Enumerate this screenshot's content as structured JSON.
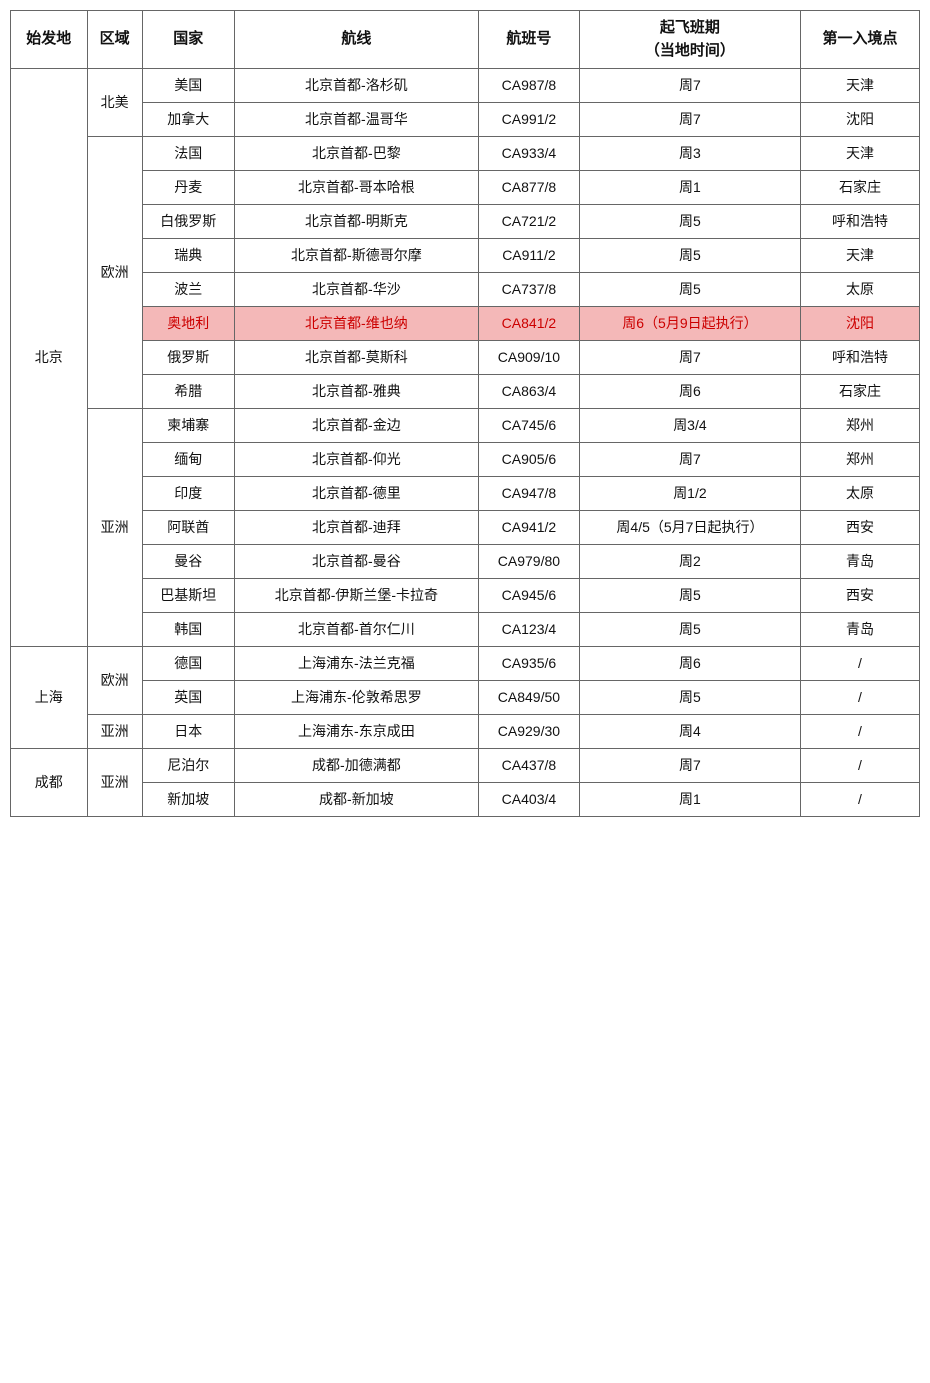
{
  "table": {
    "headers": [
      "始发地",
      "区域",
      "国家",
      "航线",
      "航班号",
      "起飞班期（当地时间）",
      "第一入境点"
    ],
    "rows": [
      {
        "origin": "北京",
        "region": "北美",
        "country": "美国",
        "route": "北京首都-洛杉矶",
        "flight": "CA987/8",
        "schedule": "周7",
        "entry": "天津",
        "highlight": false,
        "rowspan_origin": 0,
        "rowspan_region": 0
      },
      {
        "origin": "",
        "region": "",
        "country": "加拿大",
        "route": "北京首都-温哥华",
        "flight": "CA991/2",
        "schedule": "周7",
        "entry": "沈阳",
        "highlight": false,
        "rowspan_origin": 0,
        "rowspan_region": 0
      },
      {
        "origin": "",
        "region": "欧洲",
        "country": "法国",
        "route": "北京首都-巴黎",
        "flight": "CA933/4",
        "schedule": "周3",
        "entry": "天津",
        "highlight": false,
        "rowspan_origin": 0,
        "rowspan_region": 0
      },
      {
        "origin": "",
        "region": "",
        "country": "丹麦",
        "route": "北京首都-哥本哈根",
        "flight": "CA877/8",
        "schedule": "周1",
        "entry": "石家庄",
        "highlight": false
      },
      {
        "origin": "",
        "region": "",
        "country": "白俄罗斯",
        "route": "北京首都-明斯克",
        "flight": "CA721/2",
        "schedule": "周5",
        "entry": "呼和浩特",
        "highlight": false
      },
      {
        "origin": "",
        "region": "",
        "country": "瑞典",
        "route": "北京首都-斯德哥尔摩",
        "flight": "CA911/2",
        "schedule": "周5",
        "entry": "天津",
        "highlight": false
      },
      {
        "origin": "",
        "region": "",
        "country": "波兰",
        "route": "北京首都-华沙",
        "flight": "CA737/8",
        "schedule": "周5",
        "entry": "太原",
        "highlight": false
      },
      {
        "origin": "",
        "region": "",
        "country": "奥地利",
        "route": "北京首都-维也纳",
        "flight": "CA841/2",
        "schedule": "周6（5月9日起执行）",
        "entry": "沈阳",
        "highlight": true
      },
      {
        "origin": "",
        "region": "",
        "country": "俄罗斯",
        "route": "北京首都-莫斯科",
        "flight": "CA909/10",
        "schedule": "周7",
        "entry": "呼和浩特",
        "highlight": false
      },
      {
        "origin": "",
        "region": "",
        "country": "希腊",
        "route": "北京首都-雅典",
        "flight": "CA863/4",
        "schedule": "周6",
        "entry": "石家庄",
        "highlight": false
      },
      {
        "origin": "",
        "region": "亚洲",
        "country": "柬埔寨",
        "route": "北京首都-金边",
        "flight": "CA745/6",
        "schedule": "周3/4",
        "entry": "郑州",
        "highlight": false
      },
      {
        "origin": "",
        "region": "",
        "country": "缅甸",
        "route": "北京首都-仰光",
        "flight": "CA905/6",
        "schedule": "周7",
        "entry": "郑州",
        "highlight": false
      },
      {
        "origin": "",
        "region": "",
        "country": "印度",
        "route": "北京首都-德里",
        "flight": "CA947/8",
        "schedule": "周1/2",
        "entry": "太原",
        "highlight": false
      },
      {
        "origin": "",
        "region": "",
        "country": "阿联酋",
        "route": "北京首都-迪拜",
        "flight": "CA941/2",
        "schedule": "周4/5（5月7日起执行）",
        "entry": "西安",
        "highlight": false
      },
      {
        "origin": "",
        "region": "",
        "country": "曼谷",
        "route": "北京首都-曼谷",
        "flight": "CA979/80",
        "schedule": "周2",
        "entry": "青岛",
        "highlight": false
      },
      {
        "origin": "",
        "region": "",
        "country": "巴基斯坦",
        "route": "北京首都-伊斯兰堡-卡拉奇",
        "flight": "CA945/6",
        "schedule": "周5",
        "entry": "西安",
        "highlight": false
      },
      {
        "origin": "",
        "region": "",
        "country": "韩国",
        "route": "北京首都-首尔仁川",
        "flight": "CA123/4",
        "schedule": "周5",
        "entry": "青岛",
        "highlight": false
      },
      {
        "origin": "上海",
        "region": "欧洲",
        "country": "德国",
        "route": "上海浦东-法兰克福",
        "flight": "CA935/6",
        "schedule": "周6",
        "entry": "/",
        "highlight": false
      },
      {
        "origin": "",
        "region": "",
        "country": "英国",
        "route": "上海浦东-伦敦希思罗",
        "flight": "CA849/50",
        "schedule": "周5",
        "entry": "/",
        "highlight": false
      },
      {
        "origin": "",
        "region": "亚洲",
        "country": "日本",
        "route": "上海浦东-东京成田",
        "flight": "CA929/30",
        "schedule": "周4",
        "entry": "/",
        "highlight": false
      },
      {
        "origin": "成都",
        "region": "亚洲",
        "country": "尼泊尔",
        "route": "成都-加德满都",
        "flight": "CA437/8",
        "schedule": "周7",
        "entry": "/",
        "highlight": false
      },
      {
        "origin": "",
        "region": "",
        "country": "新加坡",
        "route": "成都-新加坡",
        "flight": "CA403/4",
        "schedule": "周1",
        "entry": "/",
        "highlight": false
      }
    ]
  }
}
